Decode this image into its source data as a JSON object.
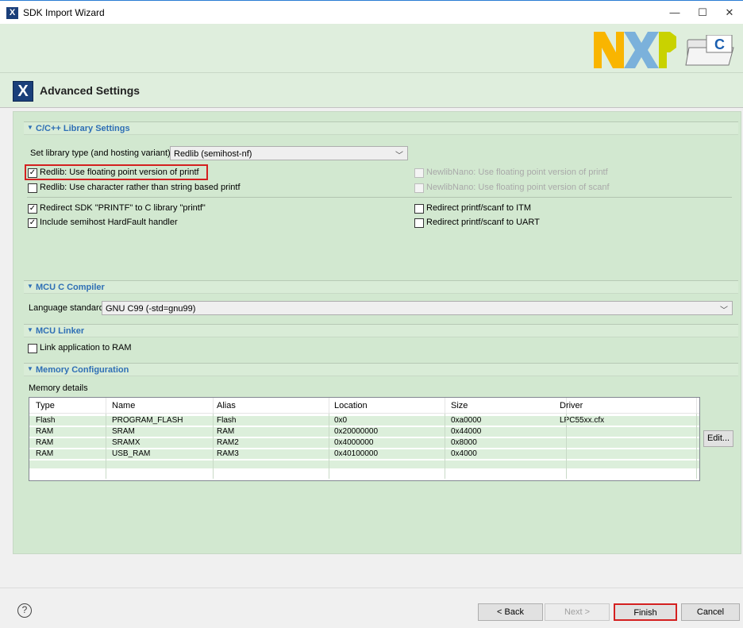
{
  "window": {
    "icon": "X",
    "title": "SDK Import Wizard",
    "minimize": "—",
    "maximize": "☐",
    "close": "✕"
  },
  "header": {
    "icon": "X",
    "title": "Advanced Settings"
  },
  "banner": {
    "logo_icon": "nxp-logo",
    "folder_icon": "folder-c-icon",
    "folder_letter": "C"
  },
  "library": {
    "section_title": "C/C++ Library Settings",
    "type_label": "Set library type (and hosting variant)",
    "type_value": "Redlib (semihost-nf)",
    "options": [
      {
        "label": "Redlib: Use floating point version of printf",
        "checked": true,
        "enabled": true
      },
      {
        "label": "Redlib: Use character rather than string based printf",
        "checked": false,
        "enabled": true
      },
      {
        "label": "NewlibNano: Use floating point version of printf",
        "checked": false,
        "enabled": false
      },
      {
        "label": "NewlibNano: Use floating point version of scanf",
        "checked": false,
        "enabled": false
      },
      {
        "label": "Redirect SDK \"PRINTF\" to C library \"printf\"",
        "checked": true,
        "enabled": true
      },
      {
        "label": "Include semihost HardFault handler",
        "checked": true,
        "enabled": true
      },
      {
        "label": "Redirect printf/scanf to ITM",
        "checked": false,
        "enabled": true
      },
      {
        "label": "Redirect printf/scanf to UART",
        "checked": false,
        "enabled": true
      }
    ]
  },
  "compiler": {
    "section_title": "MCU C Compiler",
    "lang_label": "Language standard",
    "lang_value": "GNU C99 (-std=gnu99)"
  },
  "linker": {
    "section_title": "MCU Linker",
    "ram_label": "Link application to RAM",
    "ram_checked": false
  },
  "memory": {
    "section_title": "Memory Configuration",
    "details_label": "Memory details",
    "columns": [
      "Type",
      "Name",
      "Alias",
      "Location",
      "Size",
      "Driver"
    ],
    "rows": [
      [
        "Flash",
        "PROGRAM_FLASH",
        "Flash",
        "0x0",
        "0xa0000",
        "LPC55xx.cfx"
      ],
      [
        "RAM",
        "SRAM",
        "RAM",
        "0x20000000",
        "0x44000",
        ""
      ],
      [
        "RAM",
        "SRAMX",
        "RAM2",
        "0x4000000",
        "0x8000",
        ""
      ],
      [
        "RAM",
        "USB_RAM",
        "RAM3",
        "0x40100000",
        "0x4000",
        ""
      ]
    ],
    "edit_label": "Edit..."
  },
  "footer": {
    "help": "?",
    "back": "< Back",
    "next": "Next >",
    "finish": "Finish",
    "cancel": "Cancel"
  },
  "colors": {
    "panel_green": "#d2e8d0",
    "row_green": "#dcefdb",
    "section_blue": "#2f6fb5",
    "highlight_red": "#d42020"
  }
}
